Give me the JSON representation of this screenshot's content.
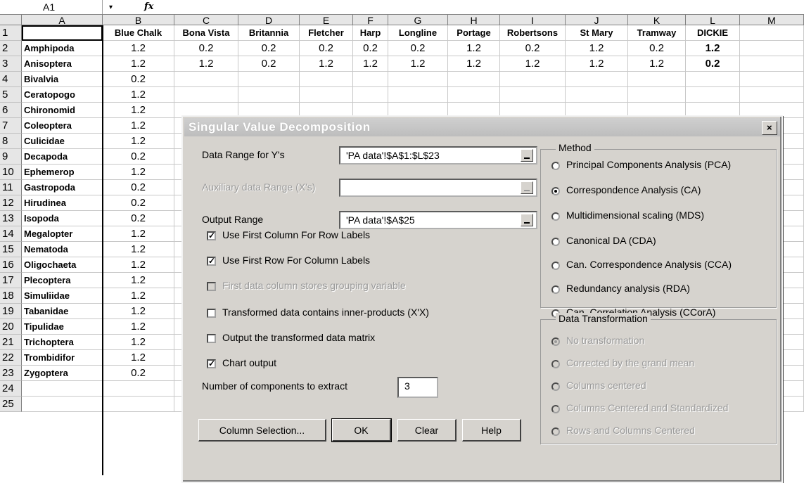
{
  "formula_bar": {
    "name_box": "A1",
    "dropdown_glyph": "▾",
    "fx": "fx"
  },
  "columns": [
    "A",
    "B",
    "C",
    "D",
    "E",
    "F",
    "G",
    "H",
    "I",
    "J",
    "K",
    "L",
    "M"
  ],
  "header_row": [
    "",
    "Blue Chalk",
    "Bona Vista",
    "Britannia",
    "Fletcher",
    "Harp",
    "Longline",
    "Portage",
    "Robertsons",
    "St Mary",
    "Tramway",
    "DICKIE"
  ],
  "row_numbers": [
    "1",
    "2",
    "3",
    "4",
    "5",
    "6",
    "7",
    "8",
    "9",
    "10",
    "11",
    "12",
    "13",
    "14",
    "15",
    "16",
    "17",
    "18",
    "19",
    "20",
    "21",
    "22",
    "23",
    "24",
    "25"
  ],
  "rows": [
    {
      "label": "Amphipoda",
      "values": [
        "1.2",
        "0.2",
        "0.2",
        "0.2",
        "0.2",
        "0.2",
        "1.2",
        "0.2",
        "1.2",
        "0.2",
        "1.2"
      ]
    },
    {
      "label": "Anisoptera",
      "values": [
        "1.2",
        "1.2",
        "0.2",
        "1.2",
        "1.2",
        "1.2",
        "1.2",
        "1.2",
        "1.2",
        "1.2",
        "0.2"
      ]
    },
    {
      "label": "Bivalvia",
      "values": [
        "0.2"
      ]
    },
    {
      "label": "Ceratopogo",
      "values": [
        "1.2"
      ]
    },
    {
      "label": "Chironomid",
      "values": [
        "1.2"
      ]
    },
    {
      "label": "Coleoptera",
      "values": [
        "1.2"
      ]
    },
    {
      "label": "Culicidae",
      "values": [
        "1.2"
      ]
    },
    {
      "label": "Decapoda",
      "values": [
        "0.2"
      ]
    },
    {
      "label": "Ephemerop",
      "values": [
        "1.2"
      ]
    },
    {
      "label": "Gastropoda",
      "values": [
        "0.2"
      ]
    },
    {
      "label": "Hirudinea",
      "values": [
        "0.2"
      ]
    },
    {
      "label": "Isopoda",
      "values": [
        "0.2"
      ]
    },
    {
      "label": "Megalopter",
      "values": [
        "1.2"
      ]
    },
    {
      "label": "Nematoda",
      "values": [
        "1.2"
      ]
    },
    {
      "label": "Oligochaeta",
      "values": [
        "1.2"
      ]
    },
    {
      "label": "Plecoptera",
      "values": [
        "1.2"
      ]
    },
    {
      "label": "Simuliidae",
      "values": [
        "1.2"
      ]
    },
    {
      "label": "Tabanidae",
      "values": [
        "1.2"
      ]
    },
    {
      "label": "Tipulidae",
      "values": [
        "1.2"
      ]
    },
    {
      "label": "Trichoptera",
      "values": [
        "1.2"
      ]
    },
    {
      "label": "Trombidifor",
      "values": [
        "1.2"
      ]
    },
    {
      "label": "Zygoptera",
      "values": [
        "0.2"
      ]
    }
  ],
  "dialog": {
    "title": "Singular Value Decomposition",
    "close": "×",
    "data_range_label": "Data Range for Y's",
    "data_range_value": "'PA data'!$A$1:$L$23",
    "aux_range_label": "Auxiliary data Range (X's)",
    "aux_range_value": "",
    "output_range_label": "Output  Range",
    "output_range_value": "'PA data'!$A$25",
    "checkboxes": [
      {
        "label": "Use First Column For Row Labels",
        "checked": true,
        "enabled": true
      },
      {
        "label": "Use First Row  For Column  Labels",
        "checked": true,
        "enabled": true
      },
      {
        "label": "First data column stores grouping variable",
        "checked": false,
        "enabled": false
      },
      {
        "label": "Transformed data contains inner-products (X'X)",
        "checked": false,
        "enabled": true
      },
      {
        "label": "Output the transformed data matrix",
        "checked": false,
        "enabled": true
      },
      {
        "label": "Chart output",
        "checked": true,
        "enabled": true
      }
    ],
    "components_label": "Number of components to extract",
    "components_value": "3",
    "method_title": "Method",
    "methods": [
      {
        "label": "Principal Components Analysis (PCA)",
        "selected": false
      },
      {
        "label": "Correspondence Analysis (CA)",
        "selected": true
      },
      {
        "label": "Multidimensional scaling (MDS)",
        "selected": false
      },
      {
        "label": "Canonical  DA (CDA)",
        "selected": false
      },
      {
        "label": "Can. Correspondence Analysis (CCA)",
        "selected": false
      },
      {
        "label": "Redundancy analysis (RDA)",
        "selected": false
      },
      {
        "label": "Can. Correlation Analysis (CCorA)",
        "selected": false
      }
    ],
    "transform_title": "Data Transformation",
    "transforms": [
      {
        "label": "No transformation",
        "selected": true
      },
      {
        "label": "Corrected by the grand mean",
        "selected": false
      },
      {
        "label": "Columns centered",
        "selected": false
      },
      {
        "label": "Columns Centered and Standardized",
        "selected": false
      },
      {
        "label": "Rows and Columns Centered",
        "selected": false
      }
    ],
    "buttons": {
      "column_selection": "Column Selection...",
      "ok": "OK",
      "clear": "Clear",
      "help": "Help"
    },
    "check_glyph": "✓"
  }
}
